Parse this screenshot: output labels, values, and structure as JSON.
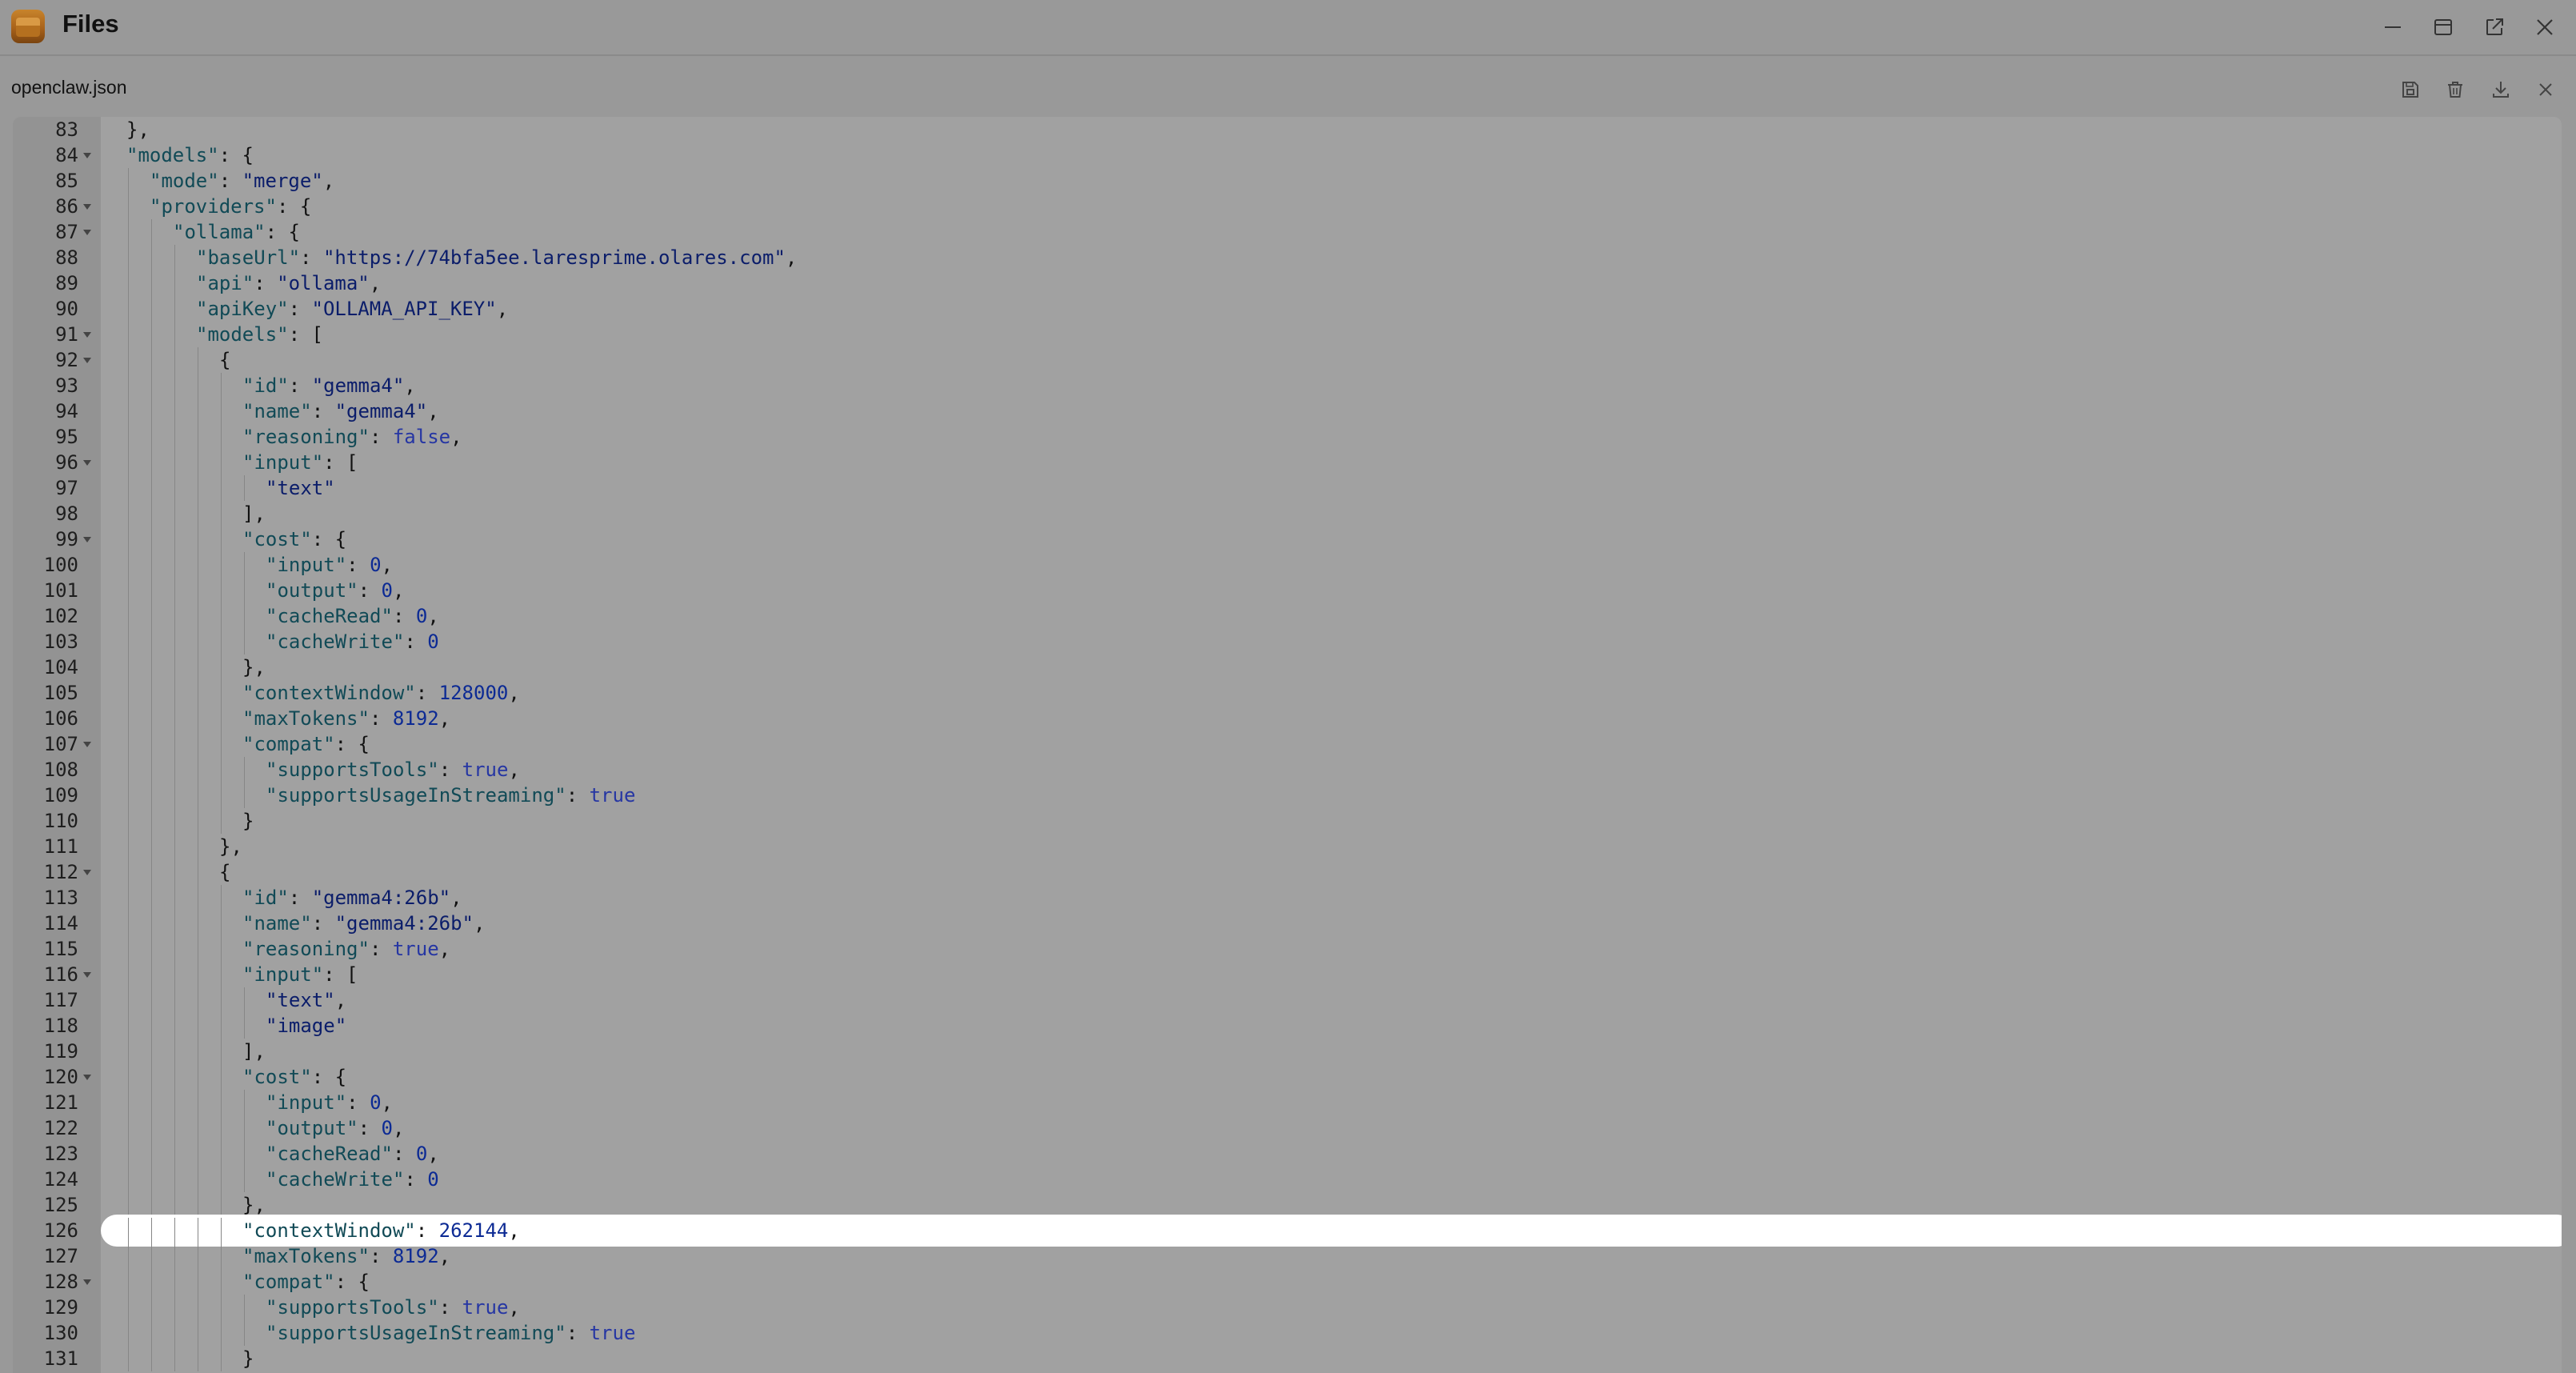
{
  "app": {
    "title": "Files",
    "icon": "files-app-icon"
  },
  "window_controls": [
    {
      "name": "minimize-button",
      "icon": "minimize-icon"
    },
    {
      "name": "maximize-button",
      "icon": "maximize-icon"
    },
    {
      "name": "open-external-button",
      "icon": "open-external-icon"
    },
    {
      "name": "close-window-button",
      "icon": "close-icon"
    }
  ],
  "file": {
    "name": "openclaw.json",
    "actions": [
      {
        "name": "save-button",
        "icon": "save-icon"
      },
      {
        "name": "delete-button",
        "icon": "trash-icon"
      },
      {
        "name": "download-button",
        "icon": "download-icon"
      },
      {
        "name": "close-file-button",
        "icon": "close-icon"
      }
    ]
  },
  "editor": {
    "highlighted_line": 126,
    "colors": {
      "key": "#114a56",
      "string": "#0b1d6a",
      "number": "#0c2a94",
      "boolean": "#2636a3"
    },
    "lines": [
      {
        "n": "83",
        "fold": false,
        "indent": 0,
        "tokens": [
          [
            "p",
            "},"
          ]
        ]
      },
      {
        "n": "84",
        "fold": true,
        "indent": 0,
        "tokens": [
          [
            "k",
            "\"models\""
          ],
          [
            "p",
            ": {"
          ]
        ]
      },
      {
        "n": "85",
        "fold": false,
        "indent": 1,
        "tokens": [
          [
            "k",
            "\"mode\""
          ],
          [
            "p",
            ": "
          ],
          [
            "s",
            "\"merge\""
          ],
          [
            "p",
            ","
          ]
        ]
      },
      {
        "n": "86",
        "fold": true,
        "indent": 1,
        "tokens": [
          [
            "k",
            "\"providers\""
          ],
          [
            "p",
            ": {"
          ]
        ]
      },
      {
        "n": "87",
        "fold": true,
        "indent": 2,
        "tokens": [
          [
            "k",
            "\"ollama\""
          ],
          [
            "p",
            ": {"
          ]
        ]
      },
      {
        "n": "88",
        "fold": false,
        "indent": 3,
        "tokens": [
          [
            "k",
            "\"baseUrl\""
          ],
          [
            "p",
            ": "
          ],
          [
            "s",
            "\"https://74bfa5ee.laresprime.olares.com\""
          ],
          [
            "p",
            ","
          ]
        ]
      },
      {
        "n": "89",
        "fold": false,
        "indent": 3,
        "tokens": [
          [
            "k",
            "\"api\""
          ],
          [
            "p",
            ": "
          ],
          [
            "s",
            "\"ollama\""
          ],
          [
            "p",
            ","
          ]
        ]
      },
      {
        "n": "90",
        "fold": false,
        "indent": 3,
        "tokens": [
          [
            "k",
            "\"apiKey\""
          ],
          [
            "p",
            ": "
          ],
          [
            "s",
            "\"OLLAMA_API_KEY\""
          ],
          [
            "p",
            ","
          ]
        ]
      },
      {
        "n": "91",
        "fold": true,
        "indent": 3,
        "tokens": [
          [
            "k",
            "\"models\""
          ],
          [
            "p",
            ": ["
          ]
        ]
      },
      {
        "n": "92",
        "fold": true,
        "indent": 4,
        "tokens": [
          [
            "p",
            "{"
          ]
        ]
      },
      {
        "n": "93",
        "fold": false,
        "indent": 5,
        "tokens": [
          [
            "k",
            "\"id\""
          ],
          [
            "p",
            ": "
          ],
          [
            "s",
            "\"gemma4\""
          ],
          [
            "p",
            ","
          ]
        ]
      },
      {
        "n": "94",
        "fold": false,
        "indent": 5,
        "tokens": [
          [
            "k",
            "\"name\""
          ],
          [
            "p",
            ": "
          ],
          [
            "s",
            "\"gemma4\""
          ],
          [
            "p",
            ","
          ]
        ]
      },
      {
        "n": "95",
        "fold": false,
        "indent": 5,
        "tokens": [
          [
            "k",
            "\"reasoning\""
          ],
          [
            "p",
            ": "
          ],
          [
            "b",
            "false"
          ],
          [
            "p",
            ","
          ]
        ]
      },
      {
        "n": "96",
        "fold": true,
        "indent": 5,
        "tokens": [
          [
            "k",
            "\"input\""
          ],
          [
            "p",
            ": ["
          ]
        ]
      },
      {
        "n": "97",
        "fold": false,
        "indent": 6,
        "tokens": [
          [
            "s",
            "\"text\""
          ]
        ]
      },
      {
        "n": "98",
        "fold": false,
        "indent": 5,
        "tokens": [
          [
            "p",
            "],"
          ]
        ]
      },
      {
        "n": "99",
        "fold": true,
        "indent": 5,
        "tokens": [
          [
            "k",
            "\"cost\""
          ],
          [
            "p",
            ": {"
          ]
        ]
      },
      {
        "n": "100",
        "fold": false,
        "indent": 6,
        "tokens": [
          [
            "k",
            "\"input\""
          ],
          [
            "p",
            ": "
          ],
          [
            "n",
            "0"
          ],
          [
            "p",
            ","
          ]
        ]
      },
      {
        "n": "101",
        "fold": false,
        "indent": 6,
        "tokens": [
          [
            "k",
            "\"output\""
          ],
          [
            "p",
            ": "
          ],
          [
            "n",
            "0"
          ],
          [
            "p",
            ","
          ]
        ]
      },
      {
        "n": "102",
        "fold": false,
        "indent": 6,
        "tokens": [
          [
            "k",
            "\"cacheRead\""
          ],
          [
            "p",
            ": "
          ],
          [
            "n",
            "0"
          ],
          [
            "p",
            ","
          ]
        ]
      },
      {
        "n": "103",
        "fold": false,
        "indent": 6,
        "tokens": [
          [
            "k",
            "\"cacheWrite\""
          ],
          [
            "p",
            ": "
          ],
          [
            "n",
            "0"
          ]
        ]
      },
      {
        "n": "104",
        "fold": false,
        "indent": 5,
        "tokens": [
          [
            "p",
            "},"
          ]
        ]
      },
      {
        "n": "105",
        "fold": false,
        "indent": 5,
        "tokens": [
          [
            "k",
            "\"contextWindow\""
          ],
          [
            "p",
            ": "
          ],
          [
            "n",
            "128000"
          ],
          [
            "p",
            ","
          ]
        ]
      },
      {
        "n": "106",
        "fold": false,
        "indent": 5,
        "tokens": [
          [
            "k",
            "\"maxTokens\""
          ],
          [
            "p",
            ": "
          ],
          [
            "n",
            "8192"
          ],
          [
            "p",
            ","
          ]
        ]
      },
      {
        "n": "107",
        "fold": true,
        "indent": 5,
        "tokens": [
          [
            "k",
            "\"compat\""
          ],
          [
            "p",
            ": {"
          ]
        ]
      },
      {
        "n": "108",
        "fold": false,
        "indent": 6,
        "tokens": [
          [
            "k",
            "\"supportsTools\""
          ],
          [
            "p",
            ": "
          ],
          [
            "b",
            "true"
          ],
          [
            "p",
            ","
          ]
        ]
      },
      {
        "n": "109",
        "fold": false,
        "indent": 6,
        "tokens": [
          [
            "k",
            "\"supportsUsageInStreaming\""
          ],
          [
            "p",
            ": "
          ],
          [
            "b",
            "true"
          ]
        ]
      },
      {
        "n": "110",
        "fold": false,
        "indent": 5,
        "tokens": [
          [
            "p",
            "}"
          ]
        ]
      },
      {
        "n": "111",
        "fold": false,
        "indent": 4,
        "tokens": [
          [
            "p",
            "},"
          ]
        ]
      },
      {
        "n": "112",
        "fold": true,
        "indent": 4,
        "tokens": [
          [
            "p",
            "{"
          ]
        ]
      },
      {
        "n": "113",
        "fold": false,
        "indent": 5,
        "tokens": [
          [
            "k",
            "\"id\""
          ],
          [
            "p",
            ": "
          ],
          [
            "s",
            "\"gemma4:26b\""
          ],
          [
            "p",
            ","
          ]
        ]
      },
      {
        "n": "114",
        "fold": false,
        "indent": 5,
        "tokens": [
          [
            "k",
            "\"name\""
          ],
          [
            "p",
            ": "
          ],
          [
            "s",
            "\"gemma4:26b\""
          ],
          [
            "p",
            ","
          ]
        ]
      },
      {
        "n": "115",
        "fold": false,
        "indent": 5,
        "tokens": [
          [
            "k",
            "\"reasoning\""
          ],
          [
            "p",
            ": "
          ],
          [
            "b",
            "true"
          ],
          [
            "p",
            ","
          ]
        ]
      },
      {
        "n": "116",
        "fold": true,
        "indent": 5,
        "tokens": [
          [
            "k",
            "\"input\""
          ],
          [
            "p",
            ": ["
          ]
        ]
      },
      {
        "n": "117",
        "fold": false,
        "indent": 6,
        "tokens": [
          [
            "s",
            "\"text\""
          ],
          [
            "p",
            ","
          ]
        ]
      },
      {
        "n": "118",
        "fold": false,
        "indent": 6,
        "tokens": [
          [
            "s",
            "\"image\""
          ]
        ]
      },
      {
        "n": "119",
        "fold": false,
        "indent": 5,
        "tokens": [
          [
            "p",
            "],"
          ]
        ]
      },
      {
        "n": "120",
        "fold": true,
        "indent": 5,
        "tokens": [
          [
            "k",
            "\"cost\""
          ],
          [
            "p",
            ": {"
          ]
        ]
      },
      {
        "n": "121",
        "fold": false,
        "indent": 6,
        "tokens": [
          [
            "k",
            "\"input\""
          ],
          [
            "p",
            ": "
          ],
          [
            "n",
            "0"
          ],
          [
            "p",
            ","
          ]
        ]
      },
      {
        "n": "122",
        "fold": false,
        "indent": 6,
        "tokens": [
          [
            "k",
            "\"output\""
          ],
          [
            "p",
            ": "
          ],
          [
            "n",
            "0"
          ],
          [
            "p",
            ","
          ]
        ]
      },
      {
        "n": "123",
        "fold": false,
        "indent": 6,
        "tokens": [
          [
            "k",
            "\"cacheRead\""
          ],
          [
            "p",
            ": "
          ],
          [
            "n",
            "0"
          ],
          [
            "p",
            ","
          ]
        ]
      },
      {
        "n": "124",
        "fold": false,
        "indent": 6,
        "tokens": [
          [
            "k",
            "\"cacheWrite\""
          ],
          [
            "p",
            ": "
          ],
          [
            "n",
            "0"
          ]
        ]
      },
      {
        "n": "125",
        "fold": false,
        "indent": 5,
        "tokens": [
          [
            "p",
            "},"
          ]
        ]
      },
      {
        "n": "126",
        "fold": false,
        "indent": 5,
        "tokens": [
          [
            "k",
            "\"contextWindow\""
          ],
          [
            "p",
            ": "
          ],
          [
            "n",
            "262144"
          ],
          [
            "p",
            ","
          ]
        ]
      },
      {
        "n": "127",
        "fold": false,
        "indent": 5,
        "tokens": [
          [
            "k",
            "\"maxTokens\""
          ],
          [
            "p",
            ": "
          ],
          [
            "n",
            "8192"
          ],
          [
            "p",
            ","
          ]
        ]
      },
      {
        "n": "128",
        "fold": true,
        "indent": 5,
        "tokens": [
          [
            "k",
            "\"compat\""
          ],
          [
            "p",
            ": {"
          ]
        ]
      },
      {
        "n": "129",
        "fold": false,
        "indent": 6,
        "tokens": [
          [
            "k",
            "\"supportsTools\""
          ],
          [
            "p",
            ": "
          ],
          [
            "b",
            "true"
          ],
          [
            "p",
            ","
          ]
        ]
      },
      {
        "n": "130",
        "fold": false,
        "indent": 6,
        "tokens": [
          [
            "k",
            "\"supportsUsageInStreaming\""
          ],
          [
            "p",
            ": "
          ],
          [
            "b",
            "true"
          ]
        ]
      },
      {
        "n": "131",
        "fold": false,
        "indent": 5,
        "tokens": [
          [
            "p",
            "}"
          ]
        ]
      }
    ]
  }
}
